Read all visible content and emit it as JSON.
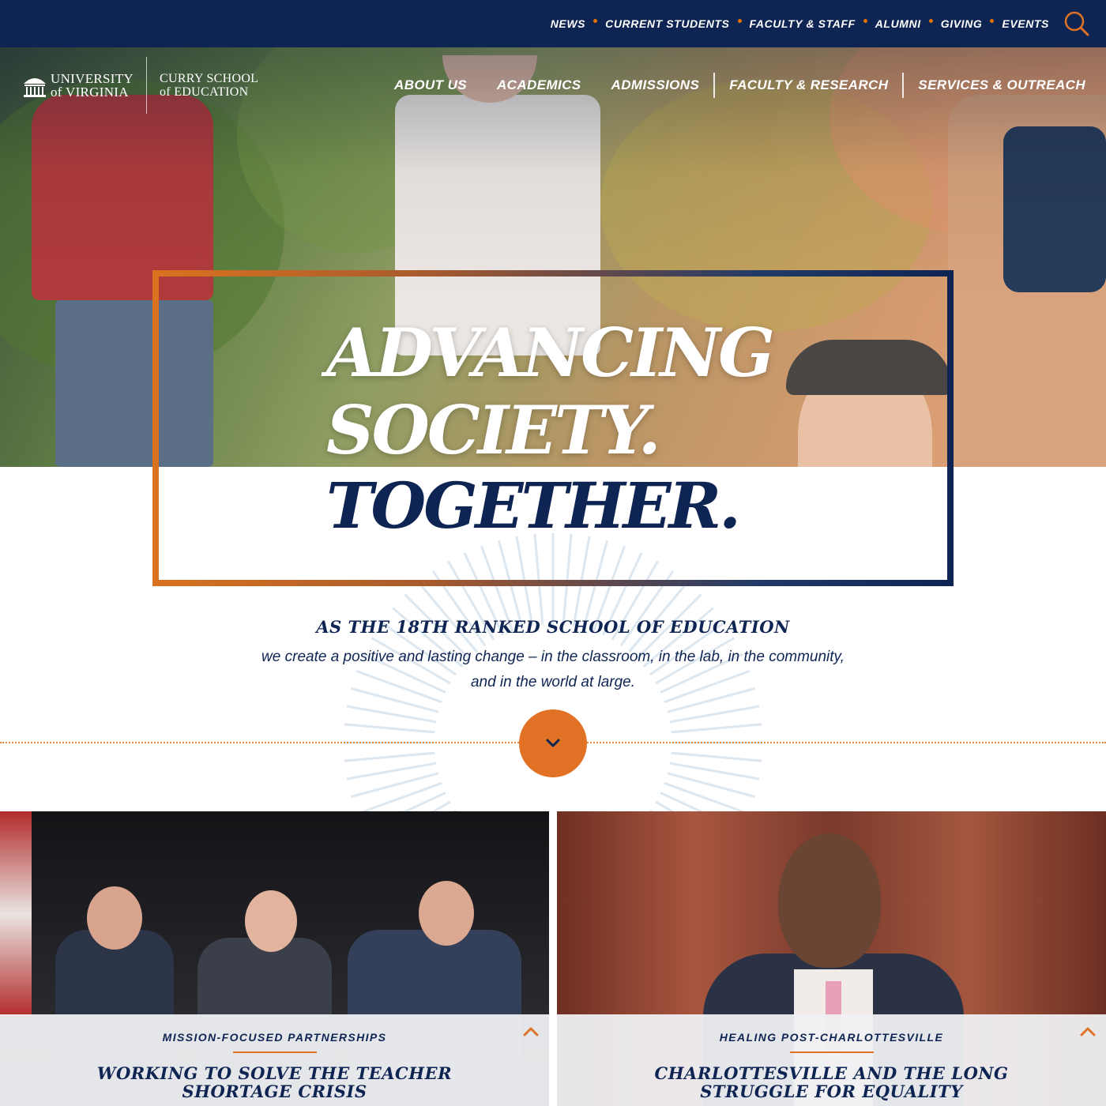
{
  "utility_nav": {
    "links": [
      "NEWS",
      "CURRENT STUDENTS",
      "FACULTY & STAFF",
      "ALUMNI",
      "GIVING",
      "EVENTS"
    ],
    "search_icon": "search-icon"
  },
  "logo": {
    "university_line1": "UNIVERSITY",
    "university_line2": "of VIRGINIA",
    "school_line1": "CURRY SCHOOL",
    "school_line2": "of EDUCATION"
  },
  "main_nav": {
    "links": [
      "ABOUT US",
      "ACADEMICS",
      "ADMISSIONS",
      "FACULTY & RESEARCH",
      "SERVICES & OUTREACH"
    ]
  },
  "hero": {
    "headline_line1": "ADVANCING",
    "headline_line2": "SOCIETY.",
    "headline_line3": "TOGETHER."
  },
  "intro": {
    "kicker": "AS THE 18TH RANKED SCHOOL OF EDUCATION",
    "body_line1": "we create a positive and lasting change – in the classroom, in the lab, in the community,",
    "body_line2": "and in the world at large.",
    "scroll_icon": "chevron-down-icon"
  },
  "cards": [
    {
      "kicker": "MISSION-FOCUSED PARTNERSHIPS",
      "title_line1": "WORKING TO SOLVE THE TEACHER",
      "title_line2": "SHORTAGE CRISIS",
      "toggle_icon": "chevron-up-icon"
    },
    {
      "kicker": "HEALING POST-CHARLOTTESVILLE",
      "title_line1": "CHARLOTTESVILLE AND THE LONG",
      "title_line2": "STRUGGLE FOR EQUALITY",
      "toggle_icon": "chevron-up-icon"
    }
  ],
  "colors": {
    "navy": "#0e2452",
    "orange": "#e07125"
  }
}
